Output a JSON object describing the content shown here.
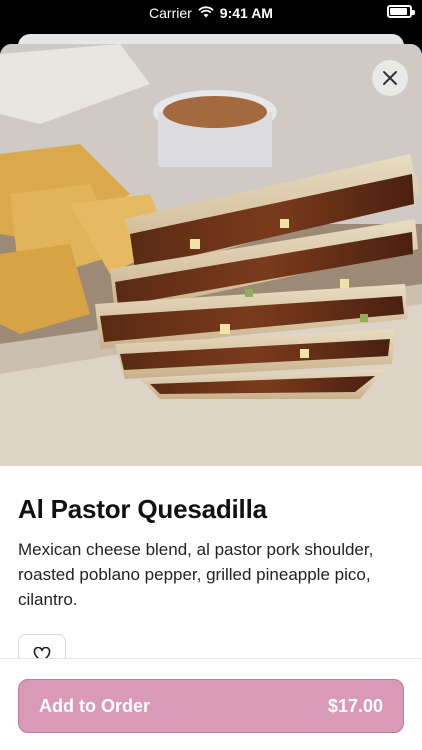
{
  "status_bar": {
    "carrier": "Carrier",
    "time": "9:41 AM"
  },
  "icons": {
    "close": "close-icon",
    "heart": "heart-icon",
    "wifi": "wifi-icon",
    "battery": "battery-icon"
  },
  "item": {
    "name": "Al Pastor Quesadilla",
    "description": "Mexican cheese blend, al pastor pork shoulder, roasted poblano pepper, grilled pineapple pico, cilantro."
  },
  "order_button": {
    "label": "Add to Order",
    "price": "$17.00"
  },
  "colors": {
    "accent": "#d89ab6",
    "accent_border": "#c3799c"
  }
}
